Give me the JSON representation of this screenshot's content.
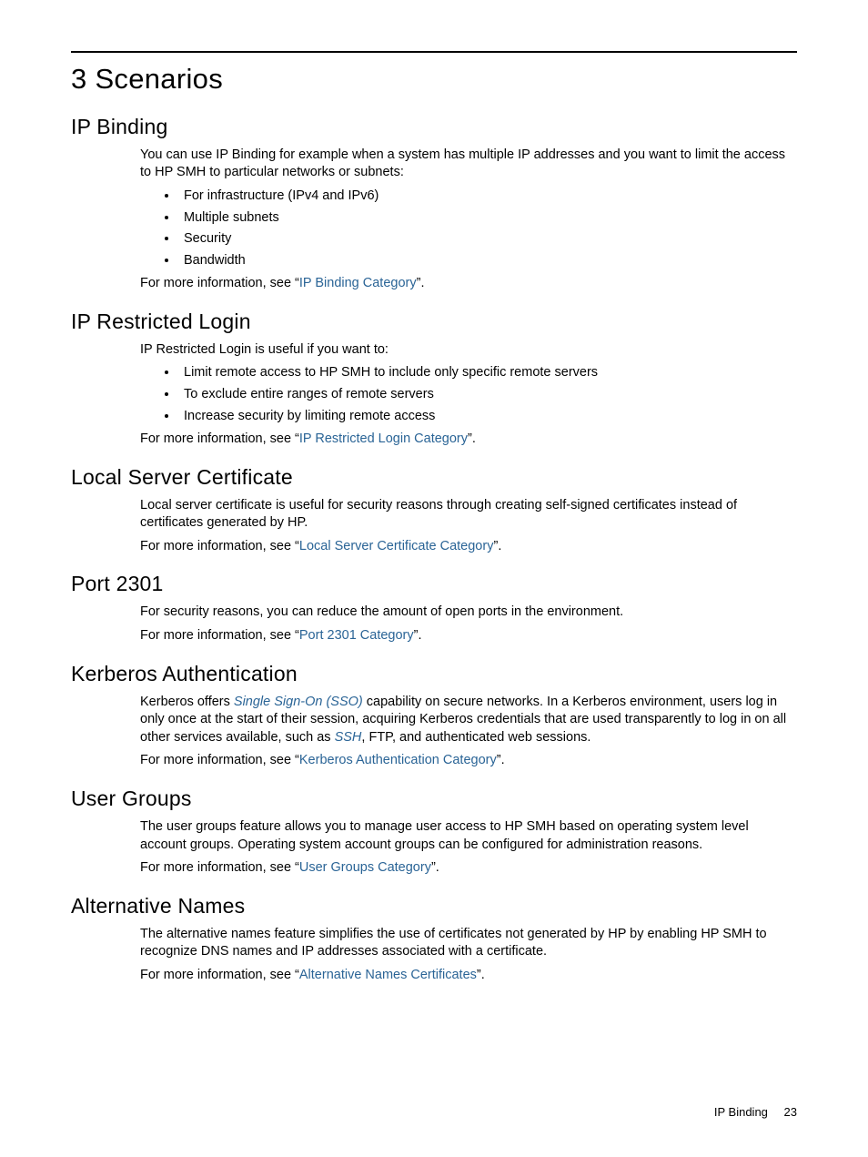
{
  "chapter_title": "3 Scenarios",
  "footer": {
    "label": "IP Binding",
    "page": "23"
  },
  "sections": {
    "ip_binding": {
      "heading": "IP Binding",
      "intro": "You can use IP Binding for example when a system has multiple IP addresses and you want to limit the access to HP SMH to particular networks or subnets:",
      "bullets": [
        "For infrastructure (IPv4 and IPv6)",
        "Multiple subnets",
        "Security",
        "Bandwidth"
      ],
      "more_prefix": "For more information, see ",
      "more_link": "IP Binding Category",
      "more_suffix": "."
    },
    "ip_restricted": {
      "heading": "IP Restricted Login",
      "intro": "IP Restricted Login is useful if you want to:",
      "bullets": [
        "Limit remote access to HP SMH to include only specific remote servers",
        "To exclude entire ranges of remote servers",
        "Increase security by limiting remote access"
      ],
      "more_prefix": "For more information, see ",
      "more_link": "IP Restricted Login Category",
      "more_suffix": "."
    },
    "local_cert": {
      "heading": "Local Server Certificate",
      "intro": "Local server certificate is useful for security reasons through creating self-signed certificates instead of certificates generated by HP.",
      "more_prefix": "For more information, see ",
      "more_link": "Local Server Certificate Category",
      "more_suffix": "."
    },
    "port": {
      "heading": "Port 2301",
      "intro": "For security reasons, you can reduce the amount of open ports in the environment.",
      "more_prefix": "For more information, see ",
      "more_link": "Port 2301 Category",
      "more_suffix": "."
    },
    "kerberos": {
      "heading": "Kerberos Authentication",
      "p1a": "Kerberos offers ",
      "p1_link1": "Single Sign-On (SSO)",
      "p1b": " capability on secure networks. In a Kerberos environment, users log in only once at the start of their session, acquiring Kerberos credentials that are used transparently to log in on all other services available, such as ",
      "p1_link2": "SSH",
      "p1c": ", FTP, and authenticated web sessions.",
      "more_prefix": "For more information, see ",
      "more_link": "Kerberos Authentication Category",
      "more_suffix": "."
    },
    "user_groups": {
      "heading": "User Groups",
      "intro": "The user groups feature allows you to manage user access to HP SMH based on operating system level account groups. Operating system account groups can be configured for administration reasons.",
      "more_prefix": "For more information, see ",
      "more_link": "User Groups Category",
      "more_suffix": "."
    },
    "alt_names": {
      "heading": "Alternative Names",
      "intro": "The alternative names feature simplifies the use of certificates not generated by HP by enabling HP SMH to recognize DNS names and IP addresses associated with a certificate.",
      "more_prefix": "For more information, see ",
      "more_link": "Alternative Names Certificates",
      "more_suffix": "."
    }
  }
}
